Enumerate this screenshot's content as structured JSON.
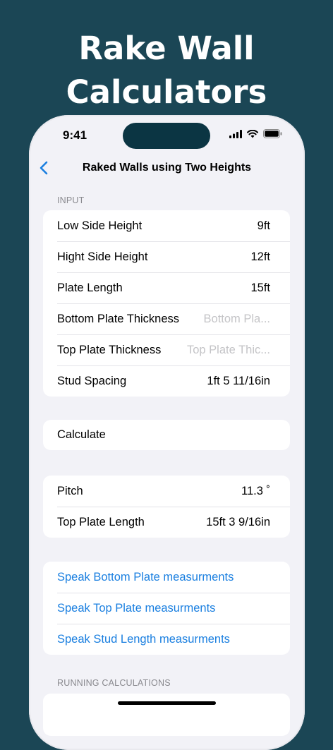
{
  "promo": {
    "line1": "Rake Wall",
    "line2": "Calculators"
  },
  "status_bar": {
    "time": "9:41"
  },
  "nav": {
    "title": "Raked Walls using Two Heights"
  },
  "input": {
    "header": "INPUT",
    "rows": [
      {
        "label": "Low Side Height",
        "value": "9ft",
        "placeholder": ""
      },
      {
        "label": "Hight Side Height",
        "value": "12ft",
        "placeholder": ""
      },
      {
        "label": "Plate Length",
        "value": "15ft",
        "placeholder": ""
      },
      {
        "label": "Bottom Plate Thickness",
        "value": "",
        "placeholder": "Bottom Pla..."
      },
      {
        "label": "Top Plate Thickness",
        "value": "",
        "placeholder": "Top Plate Thic..."
      },
      {
        "label": "Stud Spacing",
        "value": "1ft 5 11/16in",
        "placeholder": ""
      }
    ]
  },
  "calculate": {
    "label": "Calculate"
  },
  "results": {
    "rows": [
      {
        "label": "Pitch",
        "value": "11.3 ˚"
      },
      {
        "label": "Top Plate Length",
        "value": "15ft 3 9/16in"
      }
    ]
  },
  "speak": {
    "rows": [
      {
        "label": "Speak Bottom Plate measurments"
      },
      {
        "label": "Speak Top Plate measurments"
      },
      {
        "label": "Speak Stud Length measurments"
      }
    ]
  },
  "running": {
    "header": "RUNNING CALCULATIONS"
  },
  "colors": {
    "background": "#1b4655",
    "accent": "#1a7fe0",
    "screen": "#f2f2f7"
  }
}
